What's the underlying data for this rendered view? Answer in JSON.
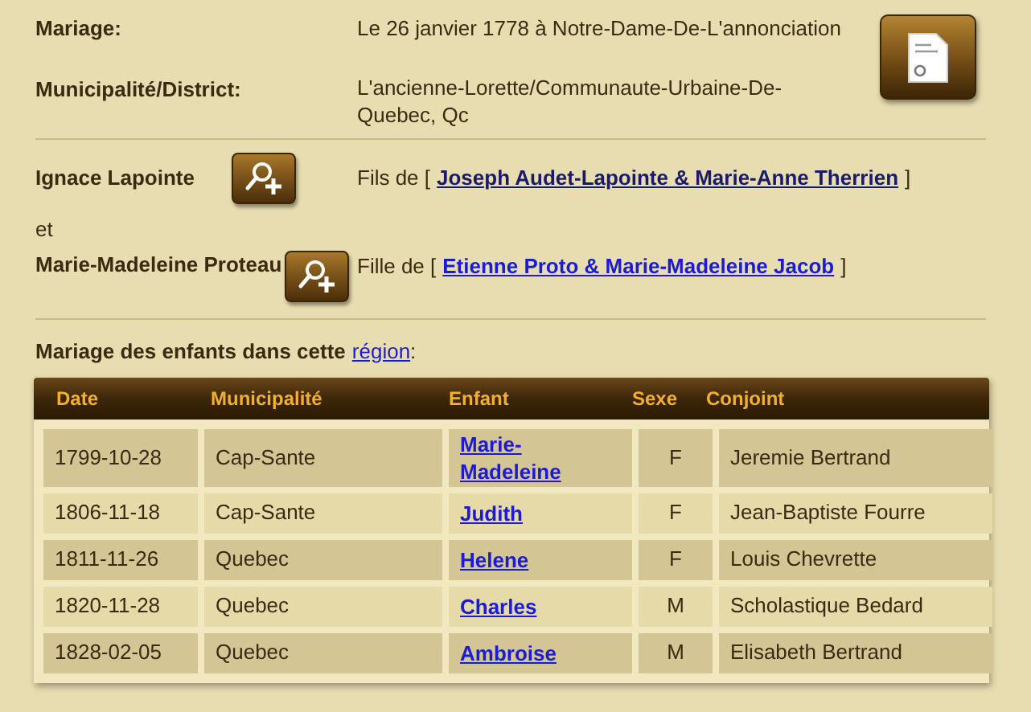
{
  "marriage": {
    "label": "Mariage:",
    "value": "Le 26 janvier 1778 à Notre-Dame-De-L'annonciation"
  },
  "district": {
    "label": "Municipalité/District:",
    "value": "L'ancienne-Lorette/Communaute-Urbaine-De-Quebec, Qc"
  },
  "spouses": [
    {
      "name": "Ignace Lapointe",
      "relation": "Fils de [",
      "parents": "Joseph Audet-Lapointe & Marie-Anne Therrien",
      "close": "]",
      "visited": true
    },
    {
      "name": "Marie-Madeleine Proteau",
      "relation": "Fille de [",
      "parents": "Etienne Proto & Marie-Madeleine Jacob",
      "close": "]",
      "visited": false
    }
  ],
  "conjunction": "et",
  "children_section": {
    "title": "Mariage des enfants dans cette",
    "link": "région",
    "suffix": ":"
  },
  "table": {
    "columns": [
      "Date",
      "Municipalité",
      "Enfant",
      "Sexe",
      "Conjoint"
    ],
    "rows": [
      {
        "date": "1799-10-28",
        "municipality": "Cap-Sante",
        "child": "Marie-Madeleine",
        "sex": "F",
        "spouse": "Jeremie Bertrand"
      },
      {
        "date": "1806-11-18",
        "municipality": "Cap-Sante",
        "child": "Judith",
        "sex": "F",
        "spouse": "Jean-Baptiste Fourre"
      },
      {
        "date": "1811-11-26",
        "municipality": "Quebec",
        "child": "Helene",
        "sex": "F",
        "spouse": "Louis Chevrette"
      },
      {
        "date": "1820-11-28",
        "municipality": "Quebec",
        "child": "Charles",
        "sex": "M",
        "spouse": "Scholastique Bedard"
      },
      {
        "date": "1828-02-05",
        "municipality": "Quebec",
        "child": "Ambroise",
        "sex": "M",
        "spouse": "Elisabeth Bertrand"
      }
    ]
  }
}
